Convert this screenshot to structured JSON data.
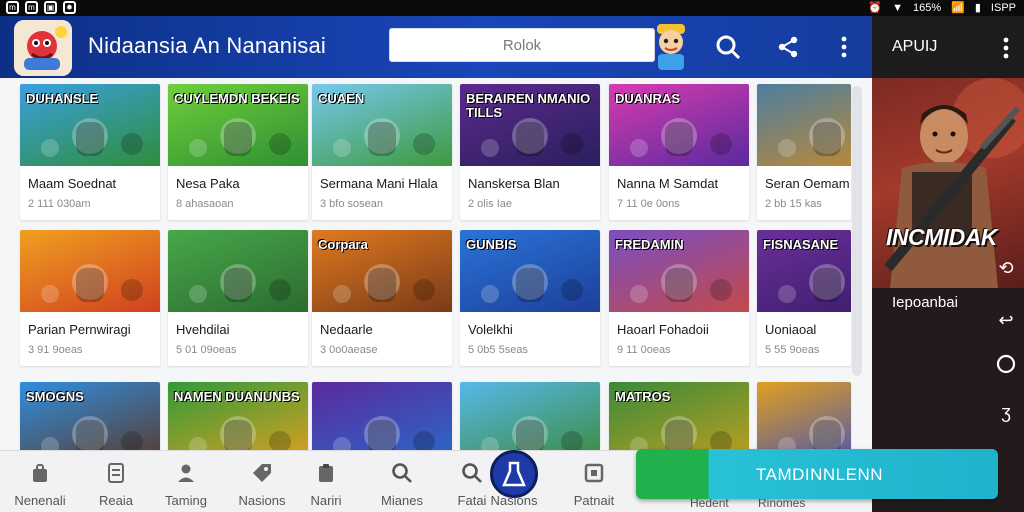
{
  "status_bar": {
    "battery": "165%",
    "carrier": "ISPP"
  },
  "header": {
    "app_title": "Nidaansia An Nananisai",
    "search_placeholder": "Rolok"
  },
  "right_panel": {
    "title": "APUIJ",
    "promo_text": "INCMIDAK",
    "label": "Iepoanbai"
  },
  "games": [
    {
      "name": "Maam Soednat",
      "meta": "2 111 030am",
      "thumb_title": "DUHANSLE",
      "bg": [
        "#3aa0e0",
        "#2f8d3a"
      ]
    },
    {
      "name": "Nesa Paka",
      "meta": "8 ahasaoan",
      "thumb_title": "CUYLEMDN BEKEIS",
      "bg": [
        "#6fcf3a",
        "#2e8f34"
      ]
    },
    {
      "name": "Sermana Mani Hlala",
      "meta": "3 bfo sosean",
      "thumb_title": "CUAEN",
      "bg": [
        "#76c8ee",
        "#3d9a3d"
      ]
    },
    {
      "name": "Nanskersa Blan",
      "meta": "2 olis Iae",
      "thumb_title": "BERAIREN NMANIO TILLS",
      "bg": [
        "#5b2a8e",
        "#2a1f5c"
      ]
    },
    {
      "name": "Nanna M Samdat",
      "meta": "7 11 0e 0ons",
      "thumb_title": "DUANRAS",
      "bg": [
        "#d63cb0",
        "#5a2a9e"
      ]
    },
    {
      "name": "Seran Oemam",
      "meta": "2 bb 15 kas",
      "thumb_title": "",
      "bg": [
        "#4d7ea0",
        "#c68a2c"
      ]
    },
    {
      "name": "Parian Pernwiragi",
      "meta": "3 91 9oeas",
      "thumb_title": "",
      "bg": [
        "#f0a020",
        "#d04020"
      ]
    },
    {
      "name": "Hvehdilai",
      "meta": "5 01 09oeas",
      "thumb_title": "",
      "bg": [
        "#47a84a",
        "#2c6b30"
      ]
    },
    {
      "name": "Nedaarle",
      "meta": "3 0o0aease",
      "thumb_title": "Corpara",
      "bg": [
        "#e07a20",
        "#7a3a18"
      ]
    },
    {
      "name": "Volelkhi",
      "meta": "5 0b5 5seas",
      "thumb_title": "GUNBIS",
      "bg": [
        "#2a74d8",
        "#1d3f9a"
      ]
    },
    {
      "name": "Haoarl Fohadoii",
      "meta": "9 11 0oeas",
      "thumb_title": "FREDAMIN",
      "bg": [
        "#7a4ec4",
        "#c24a4a"
      ]
    },
    {
      "name": "Uoniaoal",
      "meta": "5 55 9oeas",
      "thumb_title": "FISNASANE",
      "bg": [
        "#6a2f9a",
        "#3a1d6a"
      ]
    },
    {
      "name": "",
      "meta": "",
      "thumb_title": "SMOGNS",
      "bg": [
        "#2f8ee0",
        "#5a3a2a"
      ]
    },
    {
      "name": "",
      "meta": "",
      "thumb_title": "NAMEN DUANUNBS",
      "bg": [
        "#2f9a3a",
        "#e0a020"
      ]
    },
    {
      "name": "",
      "meta": "",
      "thumb_title": "",
      "bg": [
        "#5a2a9e",
        "#2a6ac8"
      ]
    },
    {
      "name": "",
      "meta": "",
      "thumb_title": "",
      "bg": [
        "#58b8ea",
        "#3a8a3a"
      ]
    },
    {
      "name": "",
      "meta": "",
      "thumb_title": "MATROS",
      "bg": [
        "#3a8a3a",
        "#c0a020"
      ]
    },
    {
      "name": "",
      "meta": "",
      "thumb_title": "",
      "bg": [
        "#e0a020",
        "#3a4ac0"
      ]
    }
  ],
  "bottom_nav": [
    {
      "label": "Nenenali",
      "icon": "bag-icon"
    },
    {
      "label": "Reaia",
      "icon": "receipt-icon"
    },
    {
      "label": "Taming",
      "icon": "user-icon"
    },
    {
      "label": "Nasions",
      "icon": "tag-icon"
    },
    {
      "label": "Nariri",
      "icon": "clipboard-icon"
    },
    {
      "label": "Mianes",
      "icon": "search-icon"
    },
    {
      "label": "Fatai",
      "icon": "search-icon"
    },
    {
      "label": "Nasions",
      "icon": "flask-icon"
    },
    {
      "label": "Patnait",
      "icon": "square-icon"
    }
  ],
  "behind_cta_labels": [
    "Hedent",
    "Rinomes"
  ],
  "cta": {
    "label": "TAMDINNLENN"
  },
  "colors": {
    "header": "#1946b8",
    "cta_green": "#21b14c",
    "cta_cyan": "#28c1d6",
    "nav_active": "#1d3aa8"
  }
}
